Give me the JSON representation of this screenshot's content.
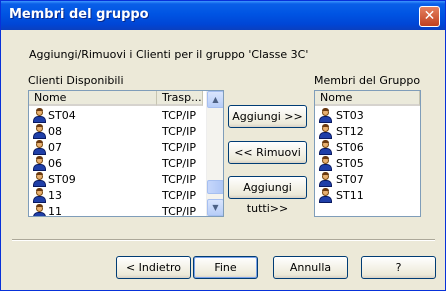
{
  "window": {
    "title": "Membri del gruppo",
    "close_label": "✕"
  },
  "instruction": "Aggiungi/Rimuovi i Clienti per il gruppo 'Classe 3C'",
  "available": {
    "label": "Clienti Disponibili",
    "columns": [
      "Nome",
      "Trasp..."
    ],
    "rows": [
      {
        "name": "ST04",
        "transport": "TCP/IP"
      },
      {
        "name": "08",
        "transport": "TCP/IP"
      },
      {
        "name": "07",
        "transport": "TCP/IP"
      },
      {
        "name": "06",
        "transport": "TCP/IP"
      },
      {
        "name": "ST09",
        "transport": "TCP/IP"
      },
      {
        "name": "13",
        "transport": "TCP/IP"
      },
      {
        "name": "11",
        "transport": "TCP/IP"
      }
    ]
  },
  "members": {
    "label": "Membri del Gruppo",
    "column": "Nome",
    "rows": [
      "ST03",
      "ST12",
      "ST06",
      "ST05",
      "ST07",
      "ST11"
    ]
  },
  "actions": {
    "add": "Aggiungi >>",
    "remove": "<< Rimuovi",
    "add_all": "Aggiungi tutti>>"
  },
  "footer": {
    "back": "< Indietro",
    "finish": "Fine",
    "cancel": "Annulla",
    "help": "?"
  },
  "icons": {
    "user": "user-icon",
    "scroll_up": "scroll-up-arrow-icon",
    "scroll_down": "scroll-down-arrow-icon"
  }
}
